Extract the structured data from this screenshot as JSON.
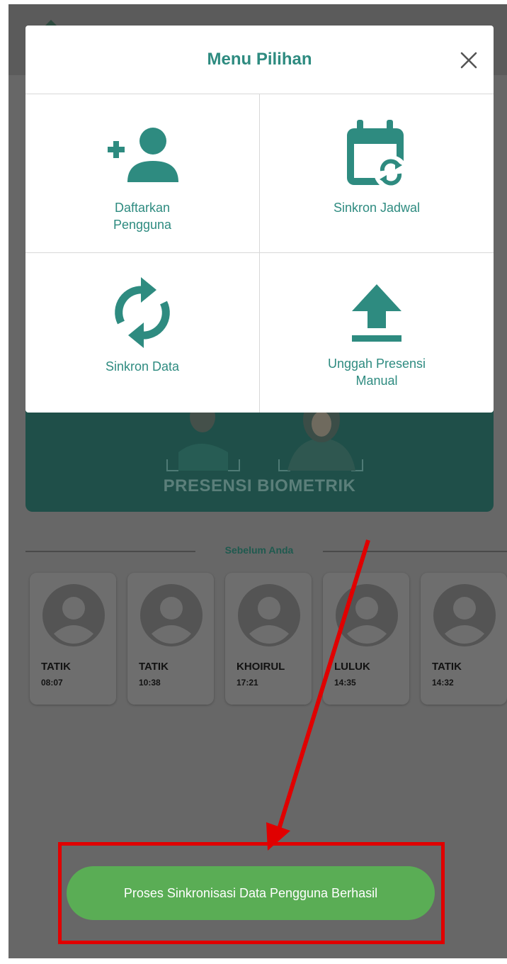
{
  "modal": {
    "title": "Menu Pilihan",
    "close_icon": "close-icon",
    "items": [
      {
        "label": "Daftarkan\nPengguna",
        "icon": "add-user-icon"
      },
      {
        "label": "Sinkron Jadwal",
        "icon": "calendar-sync-icon"
      },
      {
        "label": "Sinkron Data",
        "icon": "sync-icon"
      },
      {
        "label": "Unggah Presensi\nManual",
        "icon": "upload-icon"
      }
    ]
  },
  "background": {
    "biometric_title": "PRESENSI BIOMETRIK",
    "before_label": "Sebelum Anda",
    "history": [
      {
        "name": "TATIK",
        "time": "08:07"
      },
      {
        "name": "TATIK",
        "time": "10:38"
      },
      {
        "name": "KHOIRUL",
        "time": "17:21"
      },
      {
        "name": "LULUK",
        "time": "14:35"
      },
      {
        "name": "TATIK",
        "time": "14:32"
      }
    ]
  },
  "toast": {
    "message": "Proses Sinkronisasi Data Pengguna Berhasil"
  },
  "colors": {
    "accent": "#2e8b80",
    "toast": "#5aad55",
    "highlight": "#e00000",
    "overlay": "#676767"
  }
}
